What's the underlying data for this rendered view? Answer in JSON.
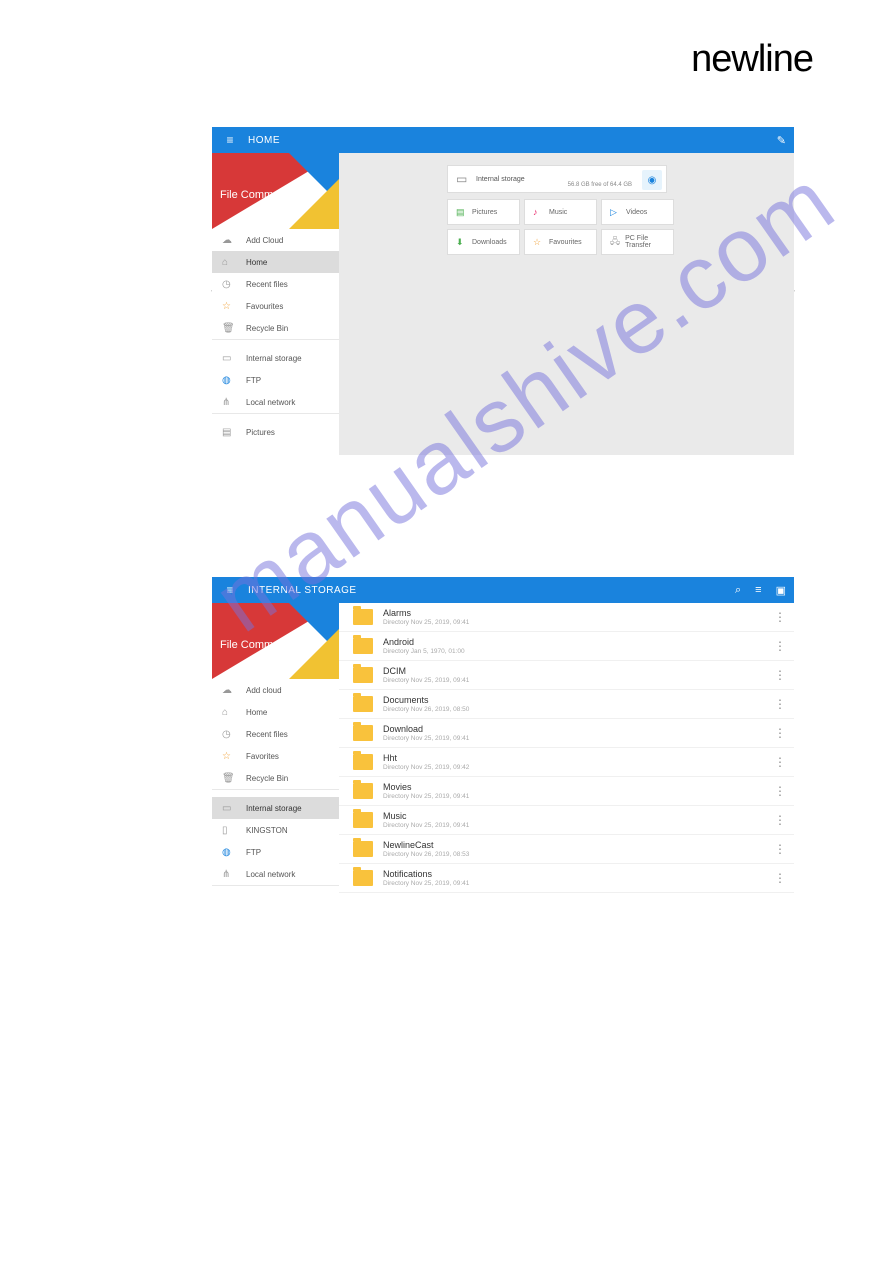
{
  "brand_logo": "newline",
  "watermark": "manualshive.com",
  "app_name": "File Commander",
  "screenshot1": {
    "header": {
      "title": "HOME"
    },
    "sidebar": {
      "items": [
        {
          "icon": "cloud",
          "label": "Add Cloud",
          "sel": false
        },
        {
          "icon": "home",
          "label": "Home",
          "sel": true
        },
        {
          "icon": "clock",
          "label": "Recent files",
          "sel": false
        },
        {
          "icon": "star",
          "label": "Favourites",
          "sel": false
        },
        {
          "icon": "bin",
          "label": "Recycle Bin",
          "sel": false
        },
        {
          "icon": "sep"
        },
        {
          "icon": "storage",
          "label": "Internal storage",
          "sel": false
        },
        {
          "icon": "ftp",
          "label": "FTP",
          "sel": false
        },
        {
          "icon": "net",
          "label": "Local network",
          "sel": false
        },
        {
          "icon": "sep"
        },
        {
          "icon": "pic",
          "label": "Pictures",
          "sel": false
        }
      ]
    },
    "storage": {
      "title": "Internal storage",
      "free": "56.8 GB free of 64.4 GB"
    },
    "tiles": [
      {
        "icon": "pic",
        "label": "Pictures"
      },
      {
        "icon": "mus",
        "label": "Music"
      },
      {
        "icon": "vid",
        "label": "Videos"
      },
      {
        "icon": "dl",
        "label": "Downloads"
      },
      {
        "icon": "fav",
        "label": "Favourites"
      },
      {
        "icon": "pc",
        "label": "PC File Transfer"
      }
    ]
  },
  "screenshot2": {
    "header": {
      "title": "INTERNAL STORAGE"
    },
    "sidebar": {
      "items": [
        {
          "icon": "cloud",
          "label": "Add cloud",
          "sel": false
        },
        {
          "icon": "home",
          "label": "Home",
          "sel": false
        },
        {
          "icon": "clock",
          "label": "Recent files",
          "sel": false
        },
        {
          "icon": "star",
          "label": "Favorites",
          "sel": false
        },
        {
          "icon": "bin",
          "label": "Recycle Bin",
          "sel": false
        },
        {
          "icon": "sep"
        },
        {
          "icon": "storage",
          "label": "Internal storage",
          "sel": true
        },
        {
          "icon": "usb",
          "label": "KINGSTON",
          "sel": false
        },
        {
          "icon": "ftp",
          "label": "FTP",
          "sel": false
        },
        {
          "icon": "net",
          "label": "Local network",
          "sel": false
        },
        {
          "icon": "sep"
        }
      ]
    },
    "files": [
      {
        "name": "Alarms",
        "meta": "Directory   Nov 25, 2019, 09:41"
      },
      {
        "name": "Android",
        "meta": "Directory   Jan 5, 1970, 01:00"
      },
      {
        "name": "DCIM",
        "meta": "Directory   Nov 25, 2019, 09:41"
      },
      {
        "name": "Documents",
        "meta": "Directory   Nov 26, 2019, 08:50"
      },
      {
        "name": "Download",
        "meta": "Directory   Nov 25, 2019, 09:41"
      },
      {
        "name": "Hht",
        "meta": "Directory   Nov 25, 2019, 09:42"
      },
      {
        "name": "Movies",
        "meta": "Directory   Nov 25, 2019, 09:41"
      },
      {
        "name": "Music",
        "meta": "Directory   Nov 25, 2019, 09:41"
      },
      {
        "name": "NewlineCast",
        "meta": "Directory   Nov 26, 2019, 08:53"
      },
      {
        "name": "Notifications",
        "meta": "Directory   Nov 25, 2019, 09:41"
      }
    ]
  },
  "icons": {
    "cloud": "☁",
    "home": "⌂",
    "clock": "◷",
    "star": "☆",
    "bin": "🗑",
    "storage": "▭",
    "ftp": "◍",
    "net": "⋔",
    "pic": "▤",
    "usb": "▯",
    "mus": "♪",
    "vid": "▷",
    "dl": "⬇",
    "fav": "☆",
    "pc": "🖧",
    "ham": "≡",
    "edit": "✎",
    "search": "⌕",
    "sort": "≡",
    "folder": "▣",
    "more": "⋮",
    "globe": "◉"
  }
}
